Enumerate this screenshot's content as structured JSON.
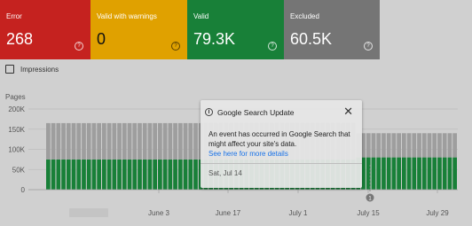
{
  "cards": [
    {
      "label": "Error",
      "value": "268",
      "color": "#c5221f",
      "width": 102
    },
    {
      "label": "Valid with warnings",
      "value": "0",
      "color": "#e0a100",
      "width": 109
    },
    {
      "label": "Valid",
      "value": "79.3K",
      "color": "#188038",
      "width": 109
    },
    {
      "label": "Excluded",
      "value": "60.5K",
      "color": "#757575",
      "width": 108
    }
  ],
  "impressions_label": "Impressions",
  "y_axis_title": "Pages",
  "chart_data": {
    "type": "bar",
    "stacked": true,
    "ylim": [
      0,
      200000
    ],
    "yticks": [
      "0",
      "50K",
      "100K",
      "150K",
      "200K"
    ],
    "xticks": [
      "June 3",
      "June 17",
      "July 1",
      "July 15",
      "July 29"
    ],
    "series": [
      {
        "name": "Valid",
        "color": "#188038"
      },
      {
        "name": "Excluded",
        "color": "#9e9e9e"
      }
    ],
    "bars": {
      "valid": [
        75000,
        75000,
        75000,
        75000,
        75000,
        75000,
        75000,
        75000,
        75000,
        75000,
        75000,
        75000,
        75000,
        75000,
        75000,
        75000,
        75000,
        75000,
        75000,
        75000,
        75000,
        75000,
        75000,
        75000,
        75000,
        75000,
        75000,
        75000,
        75000,
        75000,
        75000,
        75000,
        75000,
        75000,
        75000,
        75000,
        75000,
        75000,
        75000,
        75000,
        75000,
        75000,
        75000,
        75000,
        75000,
        75000,
        75000,
        75000,
        75000,
        75000,
        75000,
        75000,
        75000,
        75000,
        75000,
        75000,
        75000,
        75000,
        75000,
        75000,
        75000,
        80000,
        80000,
        80000,
        80000,
        80000,
        80000,
        80000,
        80000,
        80000,
        80000,
        80000,
        80000,
        80000,
        80000,
        80000,
        80000,
        80000,
        80000,
        80000,
        80000
      ],
      "excluded": [
        90000,
        90000,
        90000,
        90000,
        90000,
        90000,
        90000,
        90000,
        90000,
        90000,
        90000,
        90000,
        90000,
        90000,
        90000,
        90000,
        90000,
        90000,
        90000,
        90000,
        90000,
        90000,
        90000,
        90000,
        90000,
        90000,
        90000,
        90000,
        90000,
        90000,
        90000,
        90000,
        90000,
        90000,
        90000,
        90000,
        90000,
        90000,
        90000,
        90000,
        90000,
        90000,
        90000,
        90000,
        90000,
        90000,
        90000,
        90000,
        90000,
        90000,
        90000,
        90000,
        90000,
        90000,
        90000,
        90000,
        90000,
        90000,
        90000,
        90000,
        90000,
        60000,
        60000,
        60000,
        60000,
        60000,
        60000,
        60000,
        60000,
        60000,
        60000,
        60000,
        60000,
        60000,
        60000,
        60000,
        60000,
        60000,
        60000,
        60000,
        60000
      ]
    },
    "annotation_marker": "1"
  },
  "tooltip": {
    "title": "Google Search Update",
    "body": "An event has occurred in Google Search that might affect your site's data.",
    "link": "See here for more details",
    "date": "Sat, Jul 14",
    "close": "✕",
    "info": "i"
  }
}
